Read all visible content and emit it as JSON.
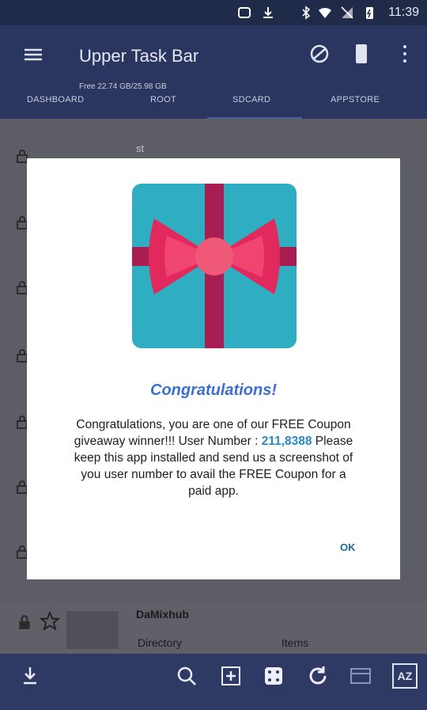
{
  "statusbar": {
    "time": "11:39"
  },
  "header": {
    "title": "Upper Task Bar",
    "storage": "Free 22.74 GB/25.98 GB",
    "tabs": [
      "DASHBOARD",
      "ROOT",
      "SDCARD",
      "APPSTORE"
    ]
  },
  "content": {
    "file_label_top": "st",
    "app_name": "DaMixhub",
    "directory": "Directory",
    "items": "Items"
  },
  "modal": {
    "title": "Congratulations!",
    "message_1": "Congratulations, you are one of our FREE Coupon giveaway winner!!! User Number : ",
    "user_number": "211,8388",
    "message_2": " Please keep this app installed and send us a screenshot of you user number to avail the FREE Coupon for a paid app.",
    "ok": "OK"
  },
  "bottombar": {
    "az_label": "AZ"
  },
  "colors": {
    "appbar": "#2a3560",
    "statusbar": "#1f2b49",
    "accent": "#3b6fd0",
    "number": "#2a8ac8"
  }
}
